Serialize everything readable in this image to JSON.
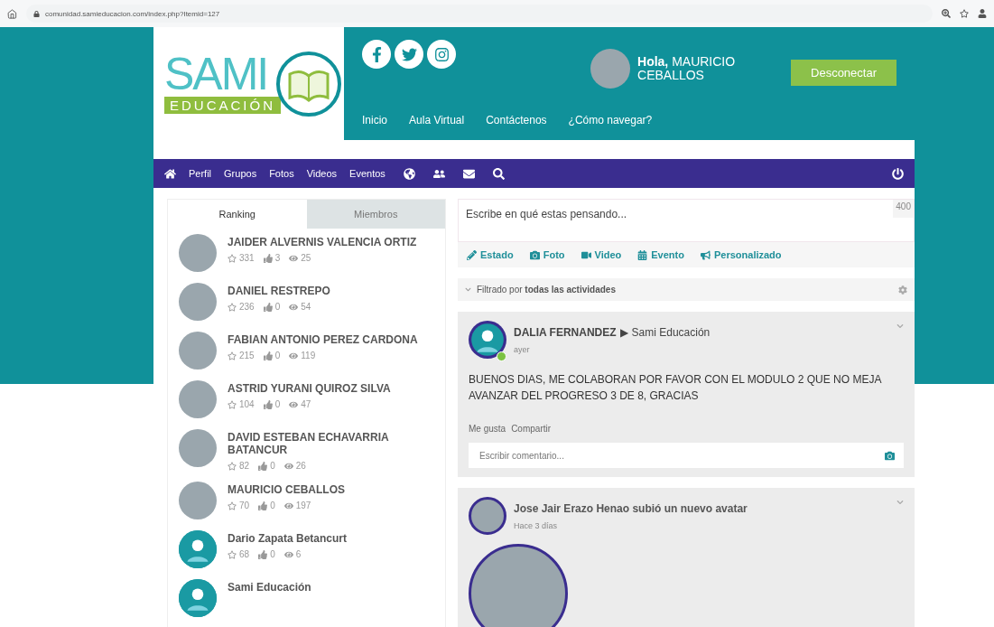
{
  "browser": {
    "url": "comunidad.samieducacion.com/index.php?Itemid=127"
  },
  "logo": {
    "title": "SAMI",
    "subtitle": "EDUCACIÓN"
  },
  "header": {
    "greeting": "**Hola,** MAURICIO CEBALLOS",
    "logout": "Desconectar",
    "links": [
      "Inicio",
      "Aula Virtual",
      "Contáctenos",
      "¿Cómo navegar?"
    ]
  },
  "nav": {
    "items": [
      {
        "kind": "home"
      },
      {
        "kind": "text",
        "label": "Perfil"
      },
      {
        "kind": "text",
        "label": "Grupos"
      },
      {
        "kind": "text",
        "label": "Fotos"
      },
      {
        "kind": "text",
        "label": "Videos"
      },
      {
        "kind": "text",
        "label": "Eventos"
      },
      {
        "kind": "globe"
      },
      {
        "kind": "friends"
      },
      {
        "kind": "mail"
      },
      {
        "kind": "search"
      }
    ]
  },
  "sidebar": {
    "tabs": [
      {
        "label": "Ranking",
        "selected": true
      },
      {
        "label": "Miembros",
        "selected": false
      }
    ],
    "members": [
      {
        "name": "JAIDER ALVERNIS VALENCIA ORTIZ",
        "photo": true,
        "points": "331",
        "likes": "3",
        "views": "25"
      },
      {
        "name": "DANIEL RESTREPO",
        "photo": true,
        "points": "236",
        "likes": "0",
        "views": "54"
      },
      {
        "name": "FABIAN ANTONIO PEREZ CARDONA",
        "photo": true,
        "points": "215",
        "likes": "0",
        "views": "119"
      },
      {
        "name": "ASTRID YURANI QUIROZ SILVA",
        "photo": true,
        "points": "104",
        "likes": "0",
        "views": "47"
      },
      {
        "name": "DAVID ESTEBAN ECHAVARRIA BATANCUR",
        "photo": true,
        "points": "82",
        "likes": "0",
        "views": "26"
      },
      {
        "name": "MAURICIO CEBALLOS",
        "photo": true,
        "points": "70",
        "likes": "0",
        "views": "197"
      },
      {
        "name": "Dario Zapata Betancurt",
        "photo": false,
        "points": "68",
        "likes": "0",
        "views": "6"
      },
      {
        "name": "Sami Educación",
        "photo": false
      }
    ]
  },
  "composer": {
    "placeholder": "Escribe en qué estas pensando...",
    "counter": "400",
    "actions": [
      {
        "kind": "status",
        "label": "Estado"
      },
      {
        "kind": "photo",
        "label": "Foto"
      },
      {
        "kind": "video",
        "label": "Video"
      },
      {
        "kind": "event",
        "label": "Evento"
      },
      {
        "kind": "custom",
        "label": "Personalizado"
      }
    ]
  },
  "filter": {
    "text": "Filtrado por **todas las actividades**"
  },
  "posts": [
    {
      "kind": "status",
      "author": "DALIA FERNANDEZ",
      "arrow": "▶",
      "target": "Sami Educación",
      "photo": false,
      "online": true,
      "time": "ayer",
      "body": "BUENOS DIAS, ME COLABORAN POR FAVOR CON EL MODULO 2 QUE NO MEJA AVANZAR DEL PROGRESO 3 DE 8, GRACIAS",
      "actions": [
        "Me gusta",
        "Compartir"
      ],
      "comment_placeholder": "Escribir comentario..."
    },
    {
      "kind": "avatar",
      "headline": "Jose Jair Erazo Henao subió un nuevo avatar",
      "photo": true,
      "time": "Hace 3 días"
    }
  ]
}
